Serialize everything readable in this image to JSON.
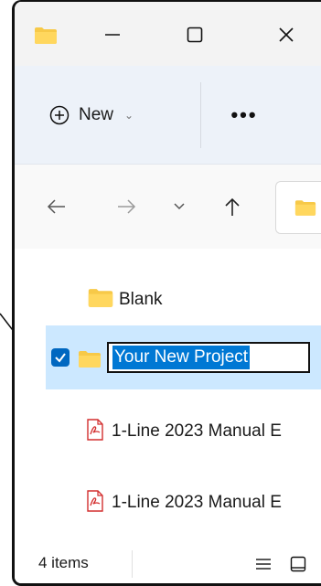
{
  "titlebar": {
    "minimize_label": "—",
    "maximize_label": "☐",
    "close_label": "✕"
  },
  "toolbar": {
    "new_label": "New",
    "new_chevron": "⌄",
    "more_label": "•••"
  },
  "nav": {
    "back_label": "←",
    "forward_label": "→",
    "recent_label": "⌄",
    "up_label": "↑"
  },
  "files": [
    {
      "name": "Blank",
      "type": "folder",
      "selected": false
    },
    {
      "name": "Your New Project",
      "type": "folder",
      "selected": true,
      "renaming": true
    },
    {
      "name": "1-Line 2023 Manual E",
      "type": "pdf",
      "selected": false
    },
    {
      "name": "1-Line 2023 Manual E",
      "type": "pdf",
      "selected": false
    }
  ],
  "status": {
    "item_count": "4 items"
  },
  "colors": {
    "accent": "#0078d4",
    "selection_bg": "#cce8ff",
    "folder_yellow": "#f7c948",
    "pdf_red": "#d32f2f",
    "toolbar_bg": "#edf2f9"
  },
  "icons": [
    "folder-icon",
    "minimize-icon",
    "maximize-icon",
    "close-icon",
    "plus-circle-icon",
    "more-icon",
    "back-arrow-icon",
    "forward-arrow-icon",
    "recent-chevron-icon",
    "up-arrow-icon",
    "checkbox-icon",
    "pdf-icon",
    "details-view-icon",
    "tiles-view-icon"
  ]
}
